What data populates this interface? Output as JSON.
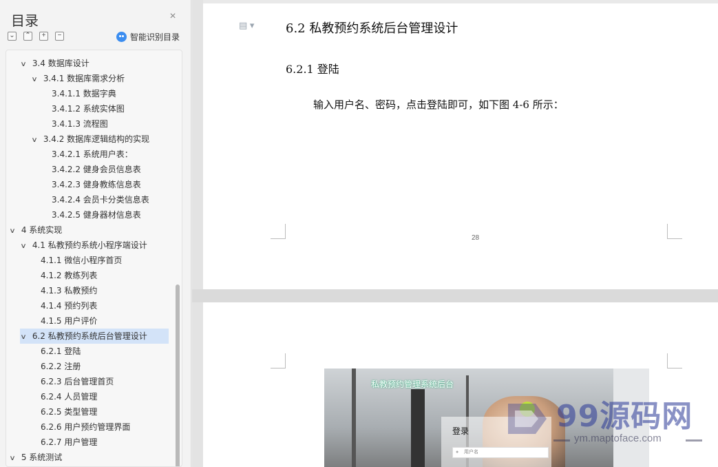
{
  "sidebar": {
    "title": "目录",
    "close_glyph": "×",
    "tools": [
      "⌄",
      "⌃",
      "+",
      "−"
    ],
    "tool_names": [
      "collapse-all",
      "expand-up",
      "expand",
      "collapse"
    ],
    "smart_label": "智能识别目录",
    "toc": [
      {
        "label": "3.4 数据库设计",
        "level": 1,
        "chevron": true
      },
      {
        "label": "3.4.1 数据库需求分析",
        "level": 2,
        "chevron": true
      },
      {
        "label": "3.4.1.1 数据字典",
        "level": 3,
        "chevron": false
      },
      {
        "label": "3.4.1.2 系统实体图",
        "level": 3,
        "chevron": false
      },
      {
        "label": "3.4.1.3 流程图",
        "level": 3,
        "chevron": false
      },
      {
        "label": "3.4.2 数据库逻辑结构的实现",
        "level": 2,
        "chevron": true
      },
      {
        "label": "3.4.2.1  系统用户表：",
        "level": 3,
        "chevron": false
      },
      {
        "label": "3.4.2.2 健身会员信息表",
        "level": 3,
        "chevron": false
      },
      {
        "label": "3.4.2.3 健身教练信息表",
        "level": 3,
        "chevron": false
      },
      {
        "label": "3.4.2.4 会员卡分类信息表",
        "level": 3,
        "chevron": false
      },
      {
        "label": "3.4.2.5 健身器材信息表",
        "level": 3,
        "chevron": false
      },
      {
        "label": "4 系统实现",
        "level": 0,
        "chevron": true
      },
      {
        "label": "4.1 私教预约系统小程序端设计",
        "level": 1,
        "chevron": true
      },
      {
        "label": "4.1.1 微信小程序首页",
        "level": 2,
        "chevron": false
      },
      {
        "label": "4.1.2 教练列表",
        "level": 2,
        "chevron": false
      },
      {
        "label": "4.1.3 私教预约",
        "level": 2,
        "chevron": false
      },
      {
        "label": "4.1.4 预约列表",
        "level": 2,
        "chevron": false
      },
      {
        "label": "4.1.5 用户评价",
        "level": 2,
        "chevron": false
      },
      {
        "label": "6.2  私教预约系统后台管理设计",
        "level": 1,
        "chevron": true,
        "selected": true
      },
      {
        "label": "6.2.1 登陆",
        "level": 2,
        "chevron": false
      },
      {
        "label": "6.2.2 注册",
        "level": 2,
        "chevron": false
      },
      {
        "label": "6.2.3 后台管理首页",
        "level": 2,
        "chevron": false
      },
      {
        "label": "6.2.4 人员管理",
        "level": 2,
        "chevron": false
      },
      {
        "label": "6.2.5 类型管理",
        "level": 2,
        "chevron": false
      },
      {
        "label": "6.2.6 用户预约管理界面",
        "level": 2,
        "chevron": false
      },
      {
        "label": "6.2.7 用户管理",
        "level": 2,
        "chevron": false
      },
      {
        "label": "5 系统测试",
        "level": 0,
        "chevron": true
      }
    ]
  },
  "document": {
    "heading2": "6.2  私教预约系统后台管理设计",
    "heading3": "6.2.1 登陆",
    "paragraph": "输入用户名、密码，点击登陆即可，如下图 4-6 所示：",
    "page_number": "28",
    "screenshot": {
      "title": "私教预约管理系统后台",
      "login_title": "登录",
      "username_placeholder": "用户名"
    }
  },
  "watermark": {
    "text": "99源码网",
    "url": "ym.maptoface.com"
  },
  "colors": {
    "selected_bg": "#d3e3f8",
    "accent": "#3b8df0"
  }
}
